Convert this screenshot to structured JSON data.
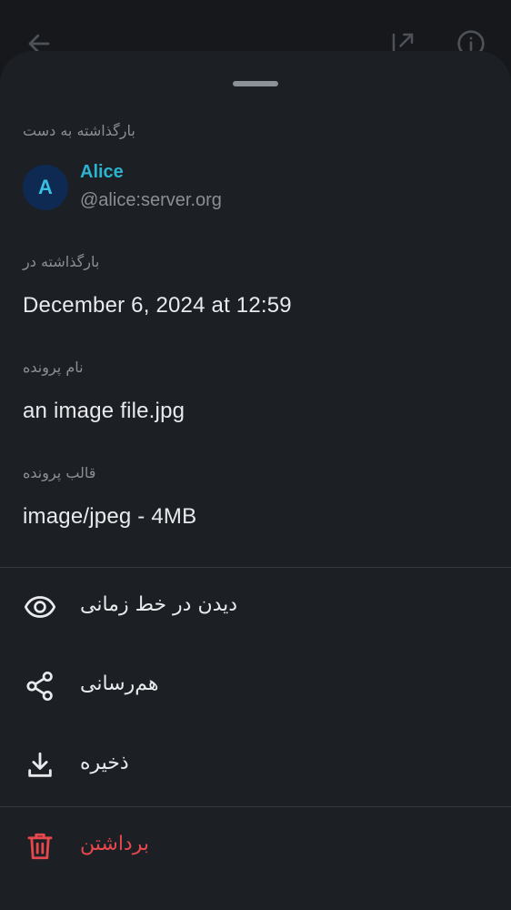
{
  "sheet": {
    "sent_by_label": "بارگذاشته به دست",
    "sender": {
      "avatar_letter": "A",
      "name": "Alice",
      "user_id": "@alice:server.org"
    },
    "sent_on_label": "بارگذاشته در",
    "sent_on_value": "December 6, 2024 at 12:59",
    "file_name_label": "نام پرونده",
    "file_name_value": "an image file.jpg",
    "file_format_label": "قالب پرونده",
    "file_format_value": "image/jpeg - 4MB"
  },
  "actions": {
    "view_in_timeline": "دیدن در خط زمانی",
    "share": "هم‌رسانی",
    "save": "ذخیره",
    "delete": "برداشتن"
  },
  "icons": {
    "back": "arrow-back-icon",
    "open_external": "open-external-icon",
    "info": "info-icon",
    "eye": "eye-icon",
    "share": "share-icon",
    "download": "download-icon",
    "delete": "trash-icon"
  },
  "colors": {
    "accent": "#2bb3cf",
    "danger": "#e5484d",
    "avatar_bg": "#0e2a52"
  }
}
